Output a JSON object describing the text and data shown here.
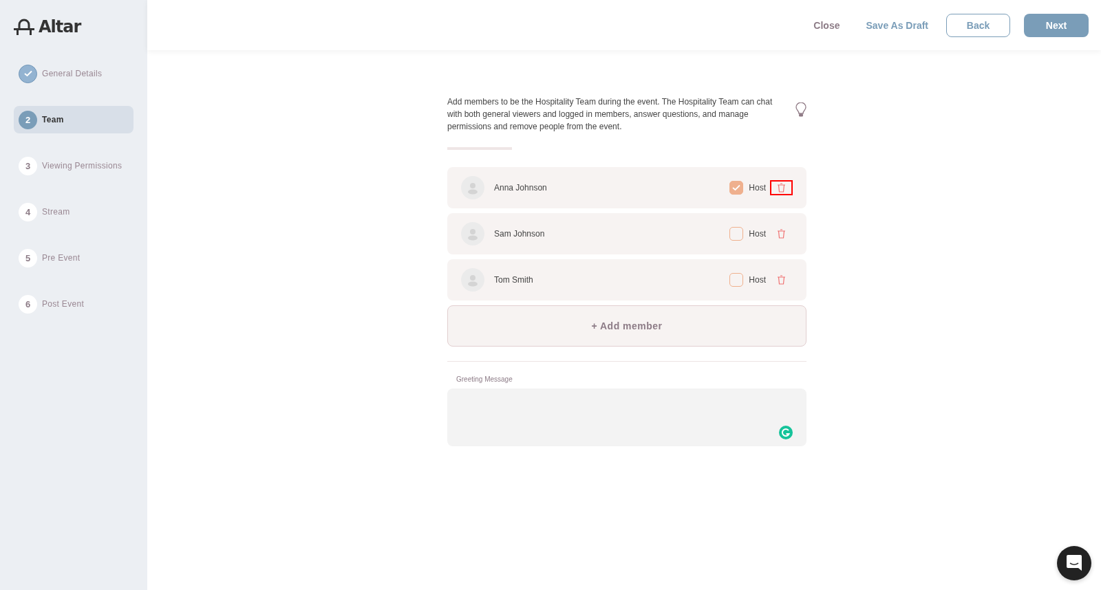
{
  "logo": {
    "text": "Altar"
  },
  "steps": [
    {
      "label": "General Details",
      "kind": "done",
      "selected": false
    },
    {
      "number": "2",
      "label": "Team",
      "kind": "current",
      "selected": true
    },
    {
      "number": "3",
      "label": "Viewing Permissions",
      "kind": "todo",
      "selected": false
    },
    {
      "number": "4",
      "label": "Stream",
      "kind": "todo",
      "selected": false
    },
    {
      "number": "5",
      "label": "Pre Event",
      "kind": "todo",
      "selected": false
    },
    {
      "number": "6",
      "label": "Post Event",
      "kind": "todo",
      "selected": false
    }
  ],
  "toolbar": [
    {
      "label": "Close",
      "kind": "link"
    },
    {
      "label": "Save As Draft",
      "kind": "accent-link"
    },
    {
      "label": "Back",
      "kind": "outline"
    },
    {
      "label": "Next",
      "kind": "primary"
    }
  ],
  "description": "Add members to be the Hospitality Team during the event. The Hospitality Team can chat with both general viewers and logged in members, answer questions, and manage permissions and remove people from the event.",
  "members": [
    {
      "name": "Anna Johnson",
      "role_label": "Host",
      "checked": true,
      "highlighted": true
    },
    {
      "name": "Sam Johnson",
      "role_label": "Host",
      "checked": false,
      "highlighted": false
    },
    {
      "name": "Tom Smith",
      "role_label": "Host",
      "checked": false,
      "highlighted": false
    }
  ],
  "add_button": "+ Add member",
  "greeting": {
    "label": "Greeting Message"
  }
}
